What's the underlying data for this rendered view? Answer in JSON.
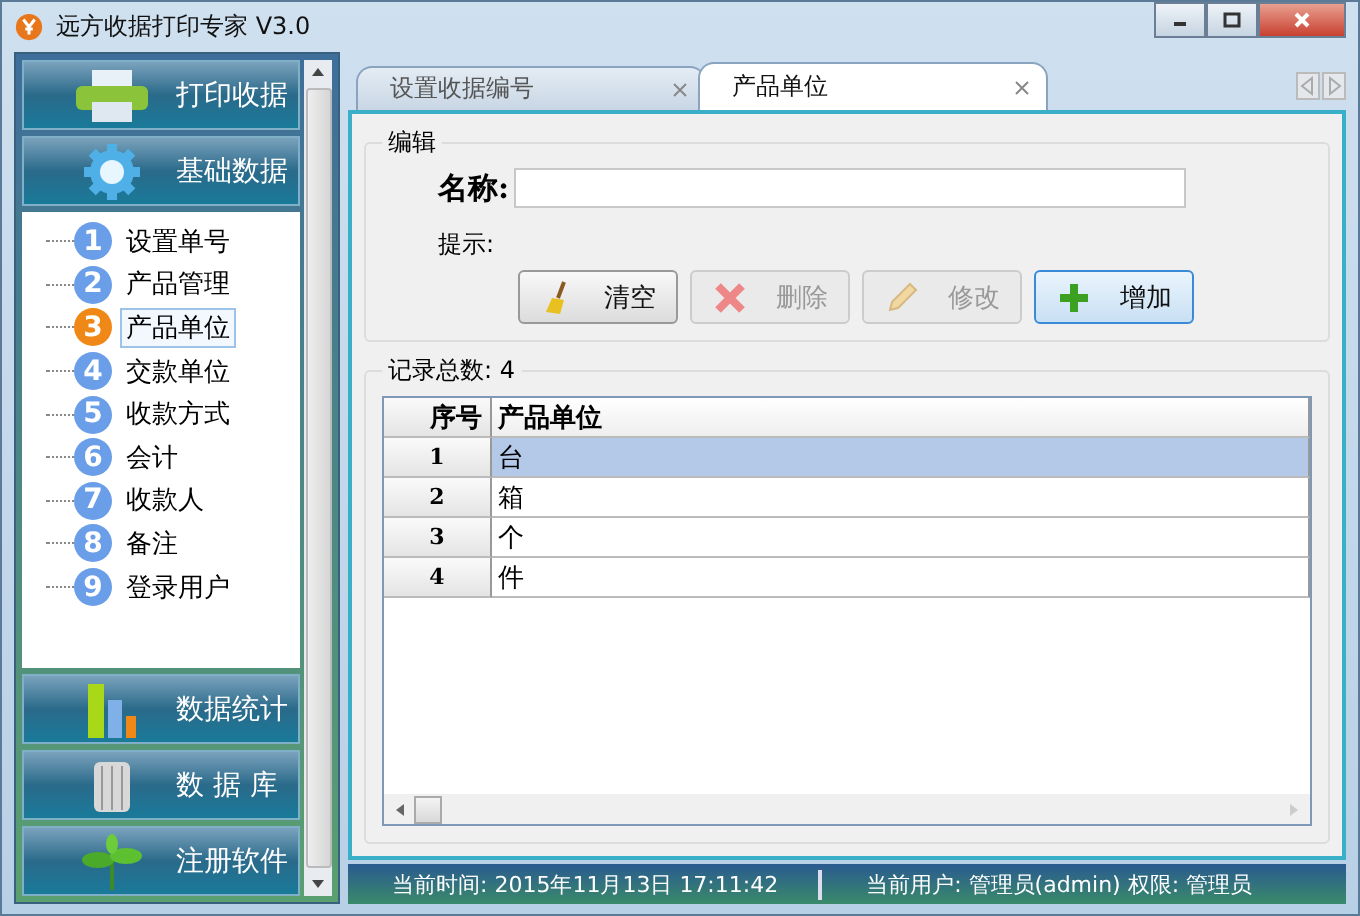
{
  "window": {
    "title": "远方收据打印专家 V3.0"
  },
  "nav_top": [
    {
      "label": "打印收据",
      "kind": "printer"
    },
    {
      "label": "基础数据",
      "kind": "gear"
    }
  ],
  "tree": [
    {
      "number": "1",
      "label": "设置单号",
      "selected": false
    },
    {
      "number": "2",
      "label": "产品管理",
      "selected": false
    },
    {
      "number": "3",
      "label": "产品单位",
      "selected": true
    },
    {
      "number": "4",
      "label": "交款单位",
      "selected": false
    },
    {
      "number": "5",
      "label": "收款方式",
      "selected": false
    },
    {
      "number": "6",
      "label": "会计",
      "selected": false
    },
    {
      "number": "7",
      "label": "收款人",
      "selected": false
    },
    {
      "number": "8",
      "label": "备注",
      "selected": false
    },
    {
      "number": "9",
      "label": "登录用户",
      "selected": false
    }
  ],
  "nav_bottom": [
    {
      "label": "数据统计",
      "kind": "chart"
    },
    {
      "label": "数 据 库",
      "kind": "database"
    },
    {
      "label": "注册软件",
      "kind": "sprout"
    }
  ],
  "tabs": [
    {
      "label": "设置收据编号",
      "selected": false
    },
    {
      "label": "产品单位",
      "selected": true
    }
  ],
  "edit_group": {
    "title": "编辑",
    "name_label": "名称:",
    "hint_label": "提示:"
  },
  "buttons": [
    {
      "label": "清空",
      "kind": "clear",
      "disabled": false,
      "focused": false
    },
    {
      "label": "删除",
      "kind": "delete",
      "disabled": true,
      "focused": false
    },
    {
      "label": "修改",
      "kind": "edit",
      "disabled": true,
      "focused": false
    },
    {
      "label": "增加",
      "kind": "add",
      "disabled": false,
      "focused": true
    }
  ],
  "records_group": {
    "title": "记录总数: 4"
  },
  "table": {
    "columns": [
      "序号",
      "产品单位"
    ],
    "rows": [
      {
        "index": "1",
        "unit": "台",
        "selected": true
      },
      {
        "index": "2",
        "unit": "箱",
        "selected": false
      },
      {
        "index": "3",
        "unit": "个",
        "selected": false
      },
      {
        "index": "4",
        "unit": "件",
        "selected": false
      }
    ]
  },
  "status_bar": [
    "当前时间: 2015年11月13日 17:11:42",
    "当前用户: 管理员(admin) 权限: 管理员"
  ]
}
